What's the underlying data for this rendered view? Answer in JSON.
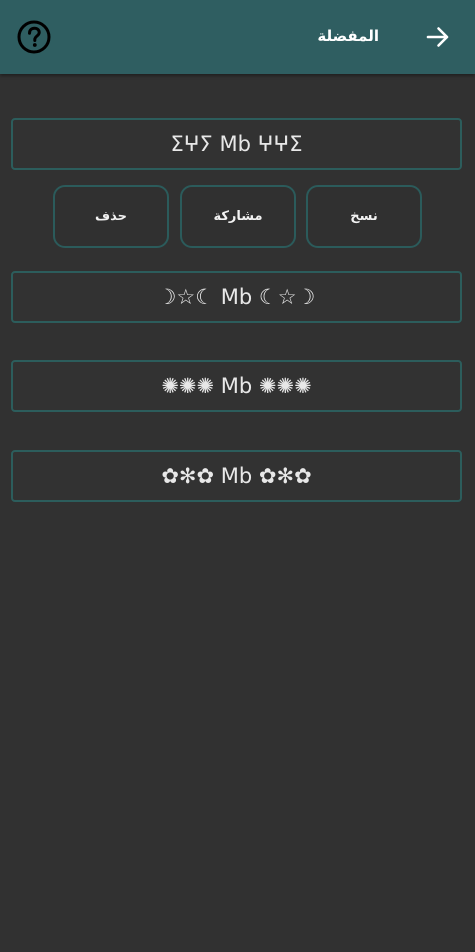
{
  "header": {
    "title": "المفضلة",
    "help_icon": "help-circle-icon",
    "back_icon": "arrow-forward-icon",
    "bar_color": "#2f5e61"
  },
  "favorites": [
    "ⵉⵖⵢ Mb ⵖⵖⵉ",
    "☽☆☾ Mb ☾☆☽",
    "✺✺✺ Mb ✺✺✺",
    "✿✻✿ Mb ✿✻✿"
  ],
  "actions": {
    "copy": "نسخ",
    "share": "مشاركة",
    "delete": "حذف"
  },
  "colors": {
    "background": "#313131",
    "accent_border": "#2c5d5c",
    "text": "#e8e8e8"
  }
}
